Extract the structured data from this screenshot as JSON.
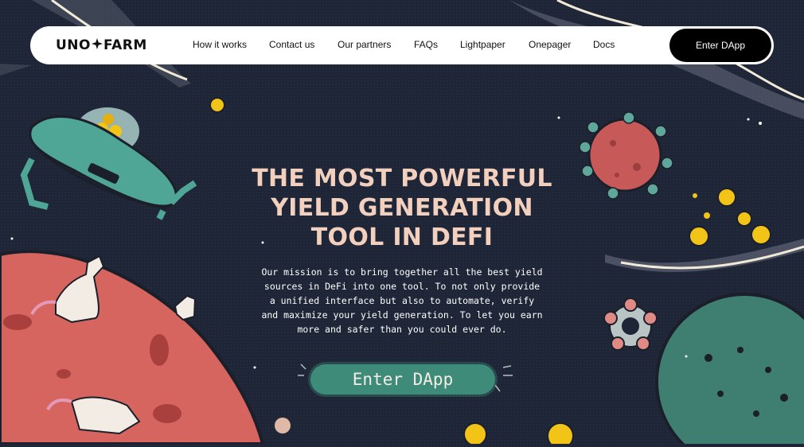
{
  "brand": {
    "logo_left": "UNO",
    "logo_right": "FARM",
    "logo_symbol": "star-icon"
  },
  "nav": {
    "links": [
      {
        "label": "How it works"
      },
      {
        "label": "Contact us"
      },
      {
        "label": "Our partners"
      },
      {
        "label": "FAQs"
      },
      {
        "label": "Lightpaper"
      },
      {
        "label": "Onepager"
      },
      {
        "label": "Docs"
      }
    ],
    "cta_label": "Enter DApp"
  },
  "hero": {
    "title_lines": [
      "THE MOST POWERFUL",
      "YIELD GENERATION",
      "TOOL IN DEFI"
    ],
    "mission": "Our mission is to bring together all the best yield sources in DeFi into one tool. To not only provide a unified interface but also to automate, verify and maximize your yield generation. To let you earn more and safer than you could ever do.",
    "cta_label": "Enter DApp"
  },
  "colors": {
    "background": "#1d2536",
    "title": "#f2d0bd",
    "cta_green": "#3f8b7a",
    "planet_red": "#d7655f",
    "planet_teal": "#3f7f72",
    "coin_yellow": "#f2c418"
  },
  "illustrations": [
    {
      "name": "ufo-robot-illustration"
    },
    {
      "name": "red-planet-illustration"
    },
    {
      "name": "unicorn-illustration"
    },
    {
      "name": "teal-planet-illustration"
    },
    {
      "name": "flower-asteroid-illustration"
    },
    {
      "name": "token-coin-icon"
    },
    {
      "name": "c-ring-illustration"
    }
  ]
}
